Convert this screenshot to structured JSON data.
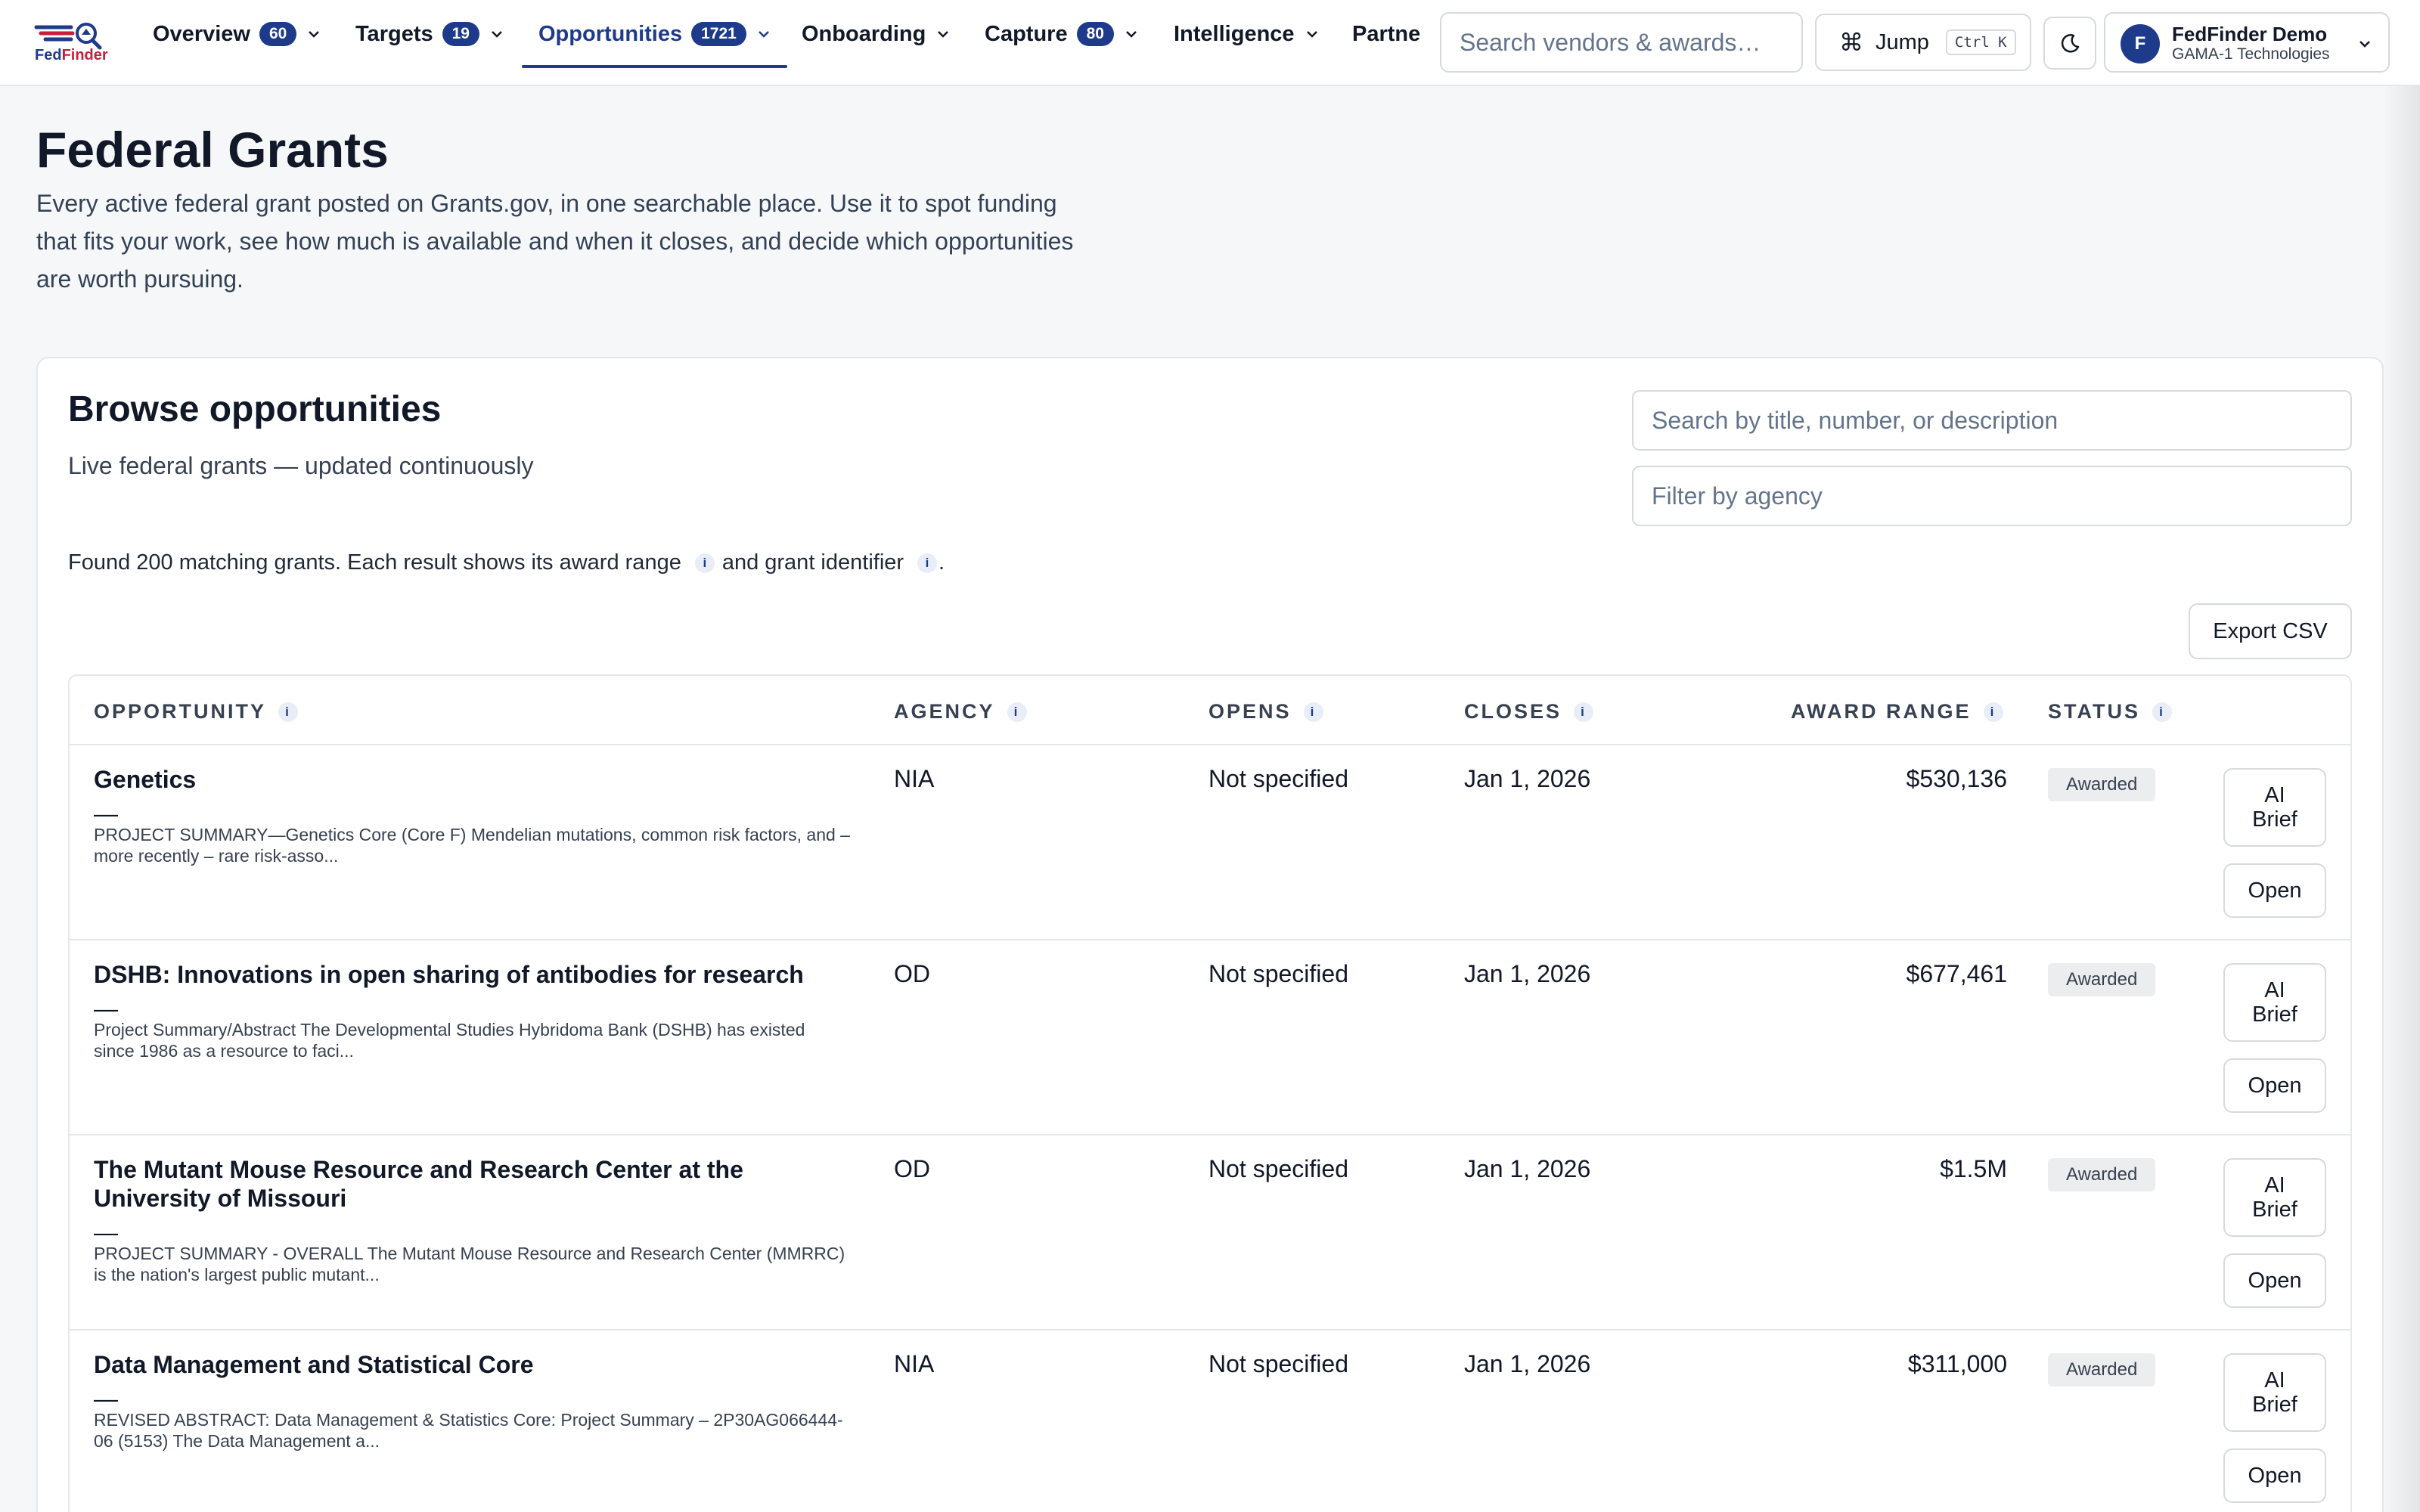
{
  "brand": {
    "name_part1": "Fed",
    "name_part2": "Finder"
  },
  "nav": {
    "items": [
      {
        "label": "Overview",
        "badge": "60"
      },
      {
        "label": "Targets",
        "badge": "19"
      },
      {
        "label": "Opportunities",
        "badge": "1721",
        "active": true
      },
      {
        "label": "Onboarding",
        "badge": ""
      },
      {
        "label": "Capture",
        "badge": "80"
      },
      {
        "label": "Intelligence",
        "badge": ""
      },
      {
        "label": "Partners",
        "badge": ""
      }
    ],
    "search_placeholder": "Search vendors & awards…",
    "jump_label": "Jump",
    "jump_shortcut": "Ctrl K",
    "user": {
      "initial": "F",
      "name": "FedFinder Demo",
      "org": "GAMA-1 Technologies"
    }
  },
  "page": {
    "title": "Federal Grants",
    "description": "Every active federal grant posted on Grants.gov, in one searchable place. Use it to spot funding that fits your work, see how much is available and when it closes, and decide which opportunities are worth pursuing."
  },
  "panel": {
    "title": "Browse opportunities",
    "subtitle": "Live federal grants — updated continuously",
    "search_placeholder": "Search by title, number, or description",
    "agency_placeholder": "Filter by agency",
    "found_prefix": "Found 200 matching grants. Each result shows its award range",
    "found_middle": "and grant identifier",
    "found_suffix": ".",
    "info_glyph": "i",
    "export_label": "Export CSV"
  },
  "table": {
    "headers": {
      "opportunity": "OPPORTUNITY",
      "agency": "AGENCY",
      "opens": "OPENS",
      "closes": "CLOSES",
      "award_range": "AWARD RANGE",
      "status": "STATUS"
    },
    "ai_label": "AI Brief",
    "open_label": "Open",
    "rows": [
      {
        "title": "Genetics",
        "dash": "—",
        "description": "PROJECT SUMMARY—Genetics Core (Core F) Mendelian mutations, common risk factors, and – more recently – rare risk-asso...",
        "agency": "NIA",
        "opens": "Not specified",
        "closes": "Jan 1, 2026",
        "award": "$530,136",
        "status": "Awarded"
      },
      {
        "title": "DSHB: Innovations in open sharing of antibodies for research",
        "dash": "—",
        "description": "Project Summary/Abstract The Developmental Studies Hybridoma Bank (DSHB) has existed since 1986 as a resource to faci...",
        "agency": "OD",
        "opens": "Not specified",
        "closes": "Jan 1, 2026",
        "award": "$677,461",
        "status": "Awarded"
      },
      {
        "title": "The Mutant Mouse Resource and Research Center at the University of Missouri",
        "dash": "—",
        "description": "PROJECT SUMMARY - OVERALL The Mutant Mouse Resource and Research Center (MMRRC) is the nation's largest public mutant...",
        "agency": "OD",
        "opens": "Not specified",
        "closes": "Jan 1, 2026",
        "award": "$1.5M",
        "status": "Awarded"
      },
      {
        "title": "Data Management and Statistical Core",
        "dash": "—",
        "description": "REVISED ABSTRACT: Data Management & Statistics Core: Project Summary – 2P30AG066444-06 (5153) The Data Management a...",
        "agency": "NIA",
        "opens": "Not specified",
        "closes": "Jan 1, 2026",
        "award": "$311,000",
        "status": "Awarded"
      }
    ]
  }
}
